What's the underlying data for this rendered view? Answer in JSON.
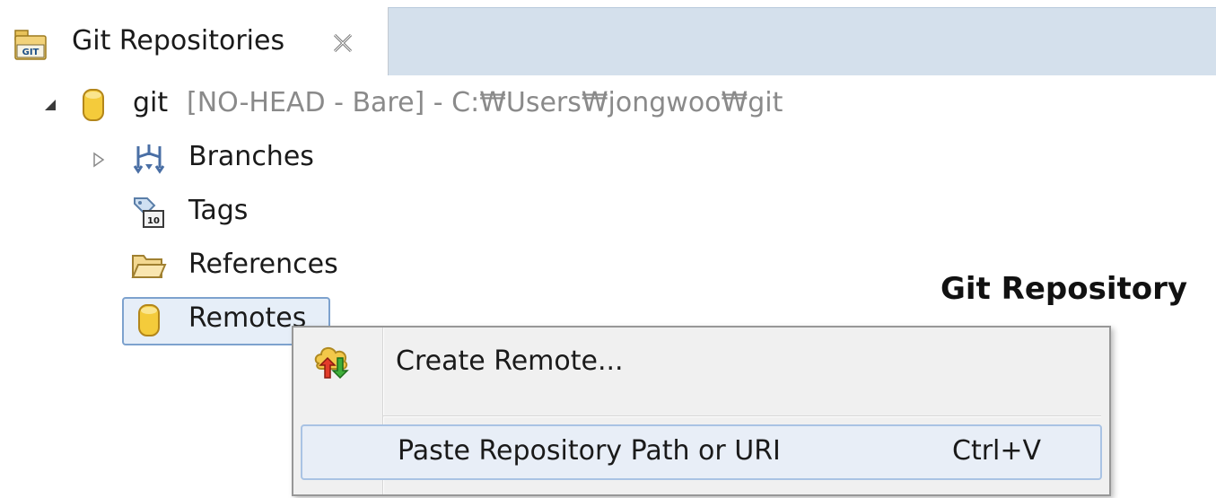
{
  "tab": {
    "title": "Git Repositories",
    "icon": "git-repositories-icon",
    "close_icon": "close-icon"
  },
  "tree": {
    "repo": {
      "name": "git",
      "decoration": "[NO-HEAD - Bare] - C:₩Users₩jongwoo₩git",
      "icon": "repository-icon",
      "expanded": true
    },
    "children": [
      {
        "label": "Branches",
        "icon": "branches-icon",
        "expandable": true
      },
      {
        "label": "Tags",
        "icon": "tags-icon",
        "expandable": false
      },
      {
        "label": "References",
        "icon": "folder-icon",
        "expandable": false
      },
      {
        "label": "Remotes",
        "icon": "remotes-icon",
        "expandable": false,
        "selected": true
      }
    ]
  },
  "overlay": {
    "title": "Git Repository"
  },
  "context_menu": {
    "items": [
      {
        "label": "Create Remote...",
        "icon": "create-remote-icon",
        "shortcut": ""
      },
      {
        "label": "Paste Repository Path or URI",
        "icon": "",
        "shortcut": "Ctrl+V",
        "hovered": true
      }
    ]
  },
  "colors": {
    "tabbar_bg": "#d4e0ec",
    "selection_border": "#7da2ce",
    "menu_bg": "#f0f0f0",
    "menu_hover": "#e8eef7",
    "decoration_text": "#8a8a8a"
  }
}
